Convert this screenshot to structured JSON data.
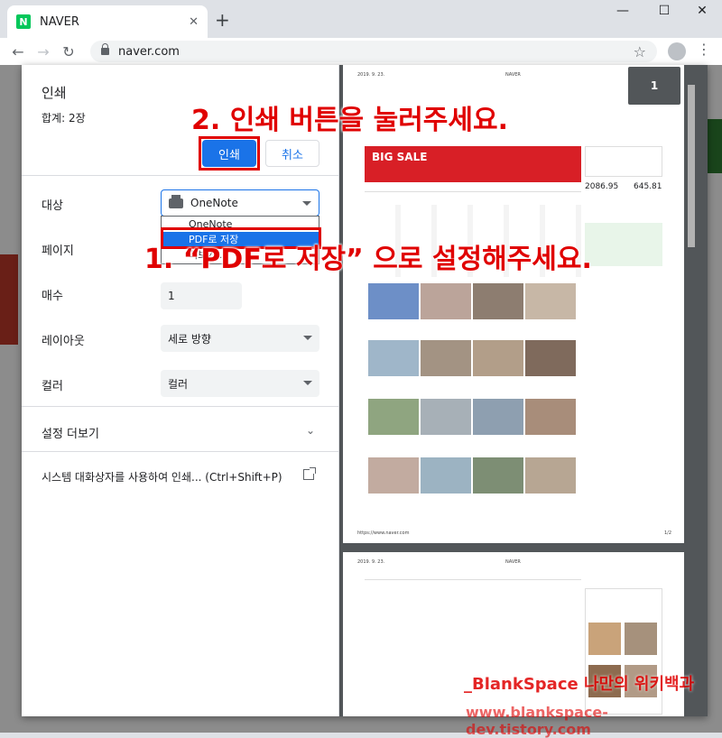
{
  "browser": {
    "tab_title": "NAVER",
    "tab_favicon": "N",
    "url": "naver.com",
    "window_controls": {
      "minimize": "—",
      "maximize": "☐",
      "close": "✕"
    }
  },
  "print_dialog": {
    "title": "인쇄",
    "total": "합계: 2장",
    "print_label": "인쇄",
    "cancel_label": "취소",
    "destination_label": "대상",
    "destination_value": "OneNote",
    "destination_options": [
      "OneNote",
      "PDF로 저장",
      "더보기..."
    ],
    "pages_label": "페이지",
    "copies_label": "매수",
    "copies_value": "1",
    "layout_label": "레이아웃",
    "layout_value": "세로 방향",
    "color_label": "컬러",
    "color_value": "컬러",
    "more_settings_label": "설정 더보기",
    "system_dialog_label": "시스템 대화상자를 사용하여 인쇄... (Ctrl+Shift+P)"
  },
  "preview": {
    "page_counter": "1",
    "page1_date": "2019. 9. 23.",
    "page1_site": "NAVER",
    "page1_footer_url": "https://www.naver.com",
    "page1_footer_num": "1/2",
    "page2_date": "2019. 9. 23.",
    "page2_site": "NAVER",
    "ad_text": "BIG SALE",
    "stock_kospi": "2086.95",
    "stock_kosdaq": "645.81"
  },
  "annotations": {
    "step2": "2. 인쇄 버튼을 눌러주세요.",
    "step1": "1. “PDF로 저장” 으로 설정해주세요.",
    "watermark_name": "_BlankSpace 나만의 위키백과",
    "watermark_url": "www.blankspace-dev.tistory.com"
  },
  "colors": {
    "accent": "#1a73e8",
    "annotation": "#e00000",
    "naver": "#03c75a",
    "preview_bg": "#525659"
  }
}
